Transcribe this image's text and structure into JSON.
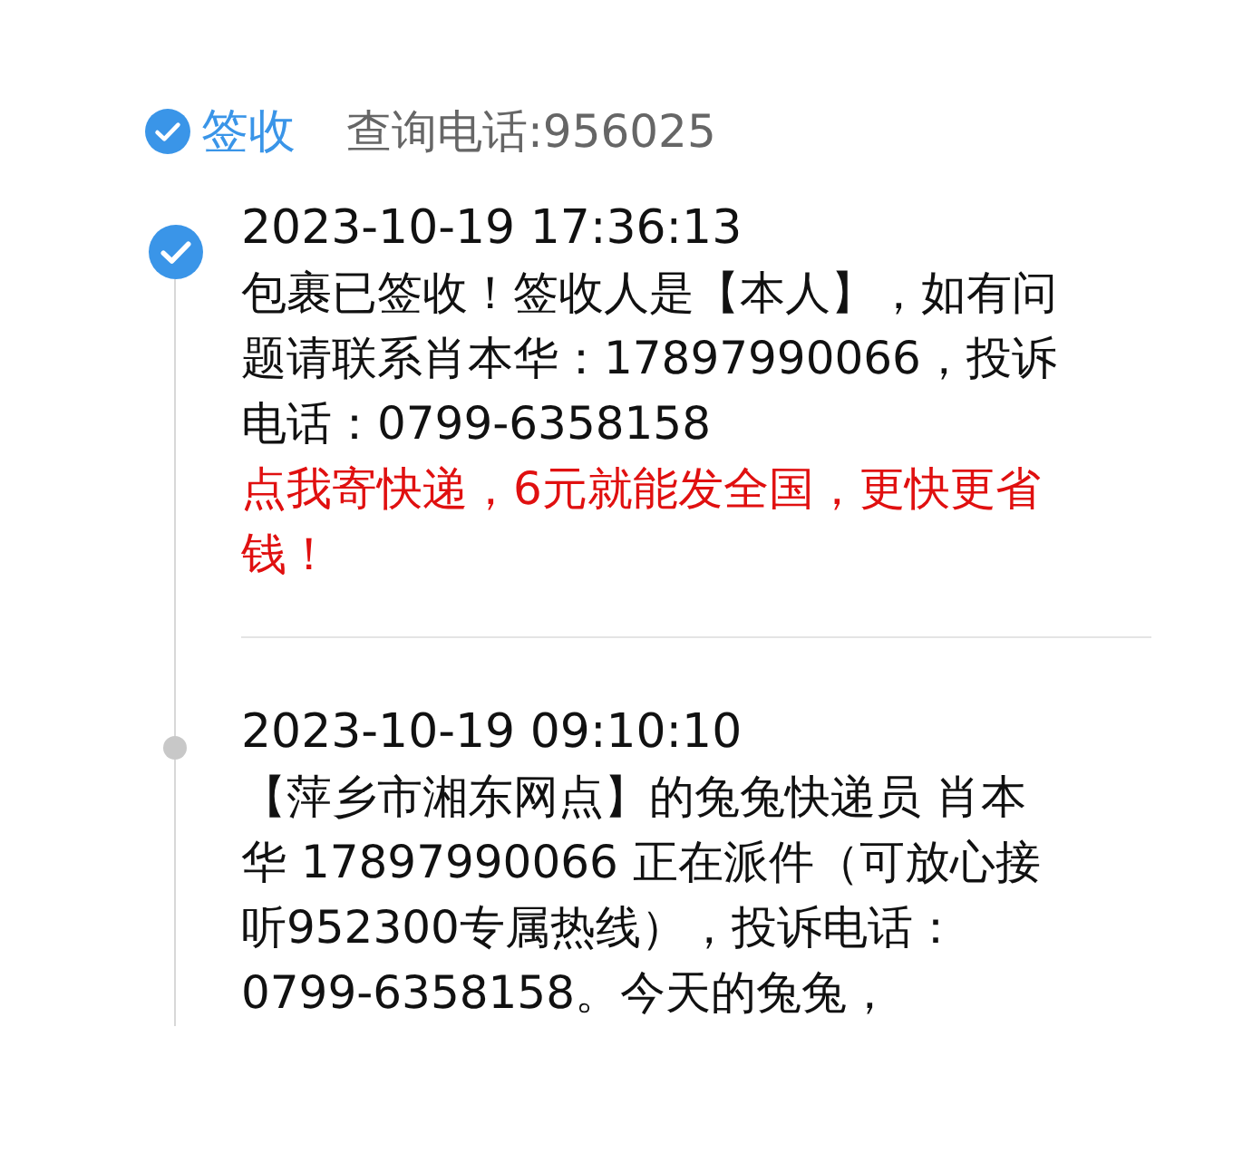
{
  "header": {
    "status": "签收",
    "phone": "查询电话:956025"
  },
  "events": [
    {
      "kind": "done",
      "time": "2023-10-19 17:36:13",
      "text": "包裹已签收！签收人是【本人】，如有问题请联系肖本华：17897990066，投诉电话：0799-6358158",
      "promo": "点我寄快递，6元就能发全国，更快更省钱！"
    },
    {
      "kind": "dot",
      "time": "2023-10-19 09:10:10",
      "text": "【萍乡市湘东网点】的兔兔快递员 肖本华 17897990066 正在派件（可放心接听952300专属热线），投诉电话：0799-6358158。今天的兔兔，"
    }
  ]
}
